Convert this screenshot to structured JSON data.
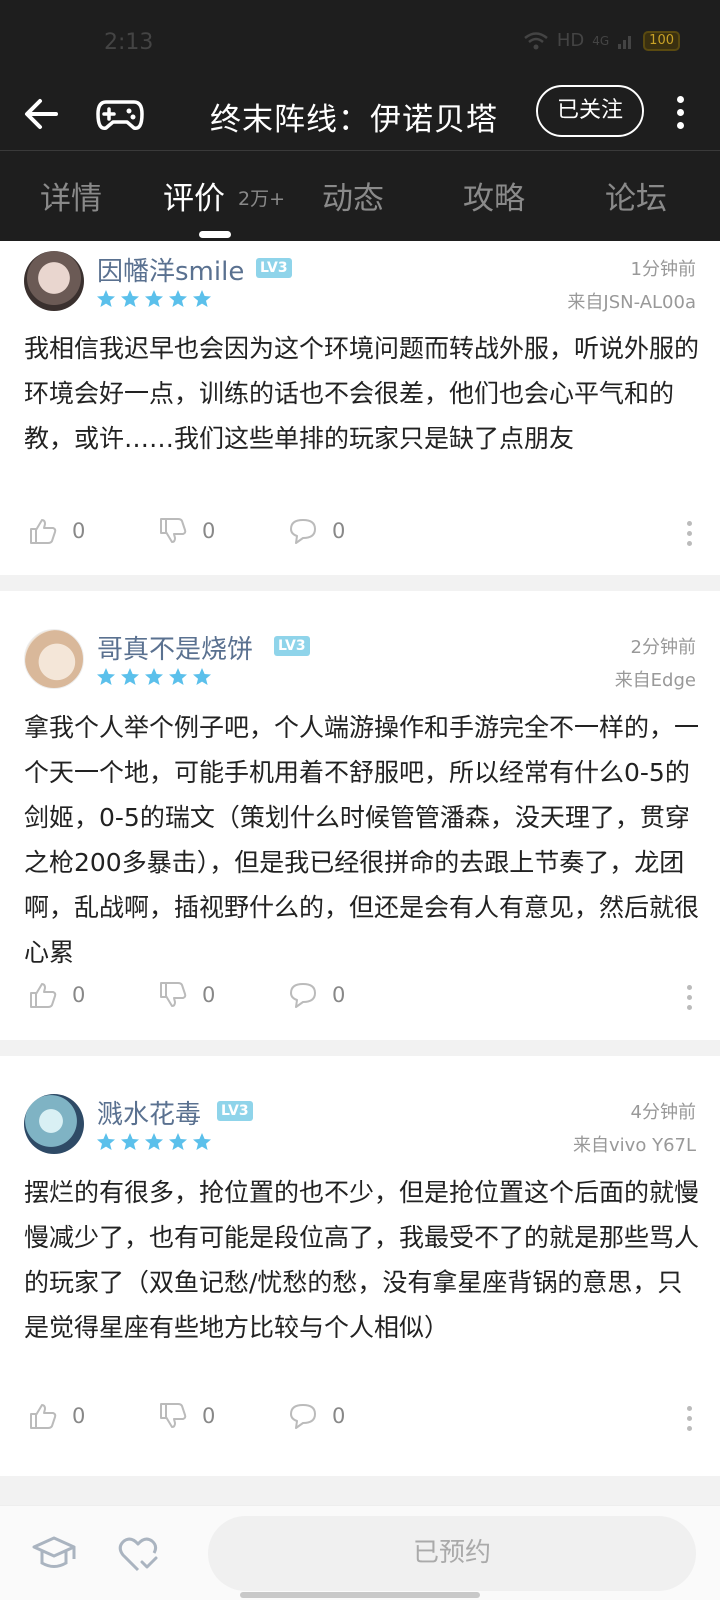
{
  "status": {
    "time": "2:13",
    "network": "HD",
    "signal": "4G",
    "battery": "100"
  },
  "header": {
    "title": "终末阵线：伊诺贝塔",
    "follow_label": "已关注"
  },
  "tabs": [
    {
      "label": "详情"
    },
    {
      "label": "评价",
      "count": "2万+"
    },
    {
      "label": "动态"
    },
    {
      "label": "攻略"
    },
    {
      "label": "论坛"
    }
  ],
  "reviews": [
    {
      "username": "因幡洋smile",
      "level": "LV3",
      "stars": 5,
      "time": "1分钟前",
      "device": "来自JSN-AL00a",
      "text": "我相信我迟早也会因为这个环境问题而转战外服，听说外服的环境会好一点，训练的话也不会很差，他们也会心平气和的教，或许……我们这些单排的玩家只是缺了点朋友",
      "likes": "0",
      "dislikes": "0",
      "comments": "0"
    },
    {
      "username": "哥真不是烧饼",
      "level": "LV3",
      "stars": 5,
      "time": "2分钟前",
      "device": "来自Edge",
      "text": "拿我个人举个例子吧，个人端游操作和手游完全不一样的，一个天一个地，可能手机用着不舒服吧，所以经常有什么0-5的剑姬，0-5的瑞文（策划什么时候管管潘森，没天理了，贯穿之枪200多暴击），但是我已经很拼命的去跟上节奏了，龙团啊，乱战啊，插视野什么的，但还是会有人有意见，然后就很心累",
      "likes": "0",
      "dislikes": "0",
      "comments": "0"
    },
    {
      "username": "溅水花毒",
      "level": "LV3",
      "stars": 5,
      "time": "4分钟前",
      "device": "来自vivo Y67L",
      "text": "摆烂的有很多，抢位置的也不少，但是抢位置这个后面的就慢慢减少了，也有可能是段位高了，我最受不了的就是那些骂人的玩家了（双鱼记愁/忧愁的愁，没有拿星座背锅的意思，只是觉得星座有些地方比较与个人相似）",
      "likes": "0",
      "dislikes": "0",
      "comments": "0"
    }
  ],
  "bottom": {
    "reserve_label": "已预约"
  },
  "colors": {
    "star": "#5bc0eb",
    "username": "#5a7190",
    "header_bg": "#1e1e1e"
  }
}
